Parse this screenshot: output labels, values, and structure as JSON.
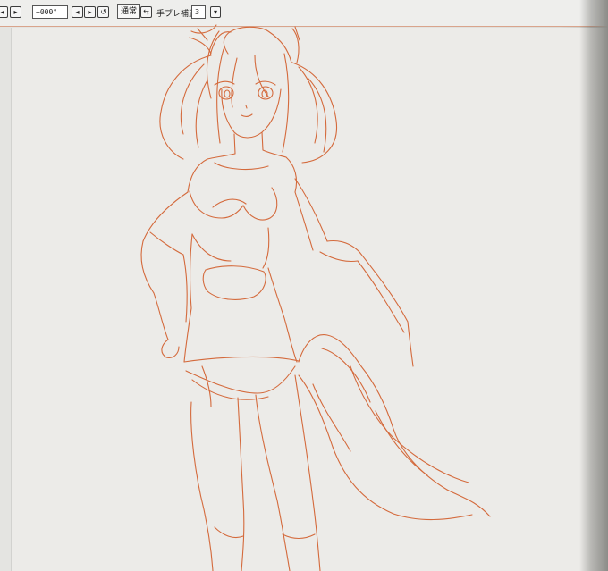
{
  "toolbar": {
    "angle_value": "+000°",
    "blend_mode": "通常",
    "stabilizer_label": "手ブレ補正",
    "stabilizer_value": "3"
  },
  "colors": {
    "stroke": "#d46a3c",
    "canvas": "#ecebe8",
    "toolbar_bg": "#eeeeec"
  },
  "icons": [
    "rotate-left-icon",
    "rotate-right-icon",
    "reset-rotation-icon",
    "flip-icon",
    "dropdown-arrow-icon"
  ]
}
